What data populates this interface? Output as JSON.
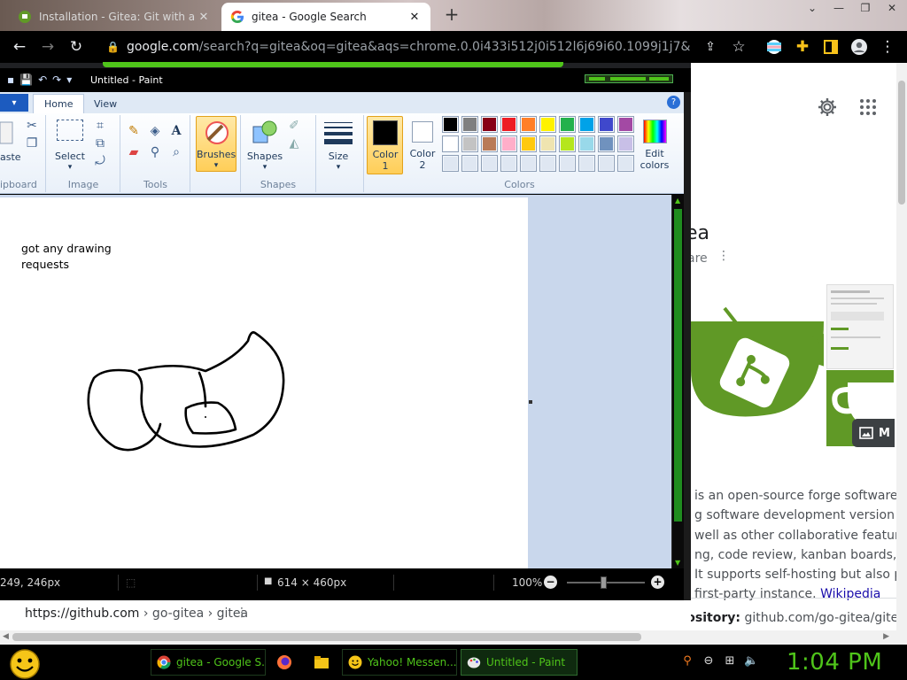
{
  "browser": {
    "tabs": [
      {
        "title": "Installation - Gitea: Git with a cu",
        "active": false
      },
      {
        "title": "gitea - Google Search",
        "active": true
      }
    ],
    "new_tab": "+",
    "close": "✕",
    "url_host": "google.com",
    "url_rest": "/search?q=gitea&oq=gitea&aqs=chrome.0.0i433i512j0i512l6j69i60.1099j1j7&sourceid=ch..."
  },
  "paint": {
    "window_title": "Untitled - Paint",
    "tabs": {
      "file": "▾",
      "home": "Home",
      "view": "View"
    },
    "help": "?",
    "ribbon": {
      "paste_label": "aste",
      "select_label": "Select",
      "brushes_label": "Brushes",
      "shapes_label": "Shapes",
      "size_label": "Size",
      "color1_label_1": "Color",
      "color1_label_2": "1",
      "color2_label_1": "Color",
      "color2_label_2": "2",
      "edit_colors_1": "Edit",
      "edit_colors_2": "colors",
      "groups": {
        "clipboard": "ipboard",
        "image": "Image",
        "tools": "Tools",
        "shapes": "Shapes",
        "colors": "Colors"
      }
    },
    "canvas_text_line1": "got any drawing",
    "canvas_text_line2": "requests",
    "status": {
      "position": "249, 246px",
      "canvas_size": "614 × 460px",
      "zoom": "100%"
    },
    "colors": {
      "row1": [
        "#000000",
        "#7f7f7f",
        "#880015",
        "#ed1c24",
        "#ff7f27",
        "#fff200",
        "#22b14c",
        "#00a2e8",
        "#3f48cc",
        "#a349a4"
      ],
      "row2": [
        "#ffffff",
        "#c3c3c3",
        "#b97a57",
        "#ffaec9",
        "#ffc90e",
        "#efe4b0",
        "#b5e61d",
        "#99d9ea",
        "#7092be",
        "#c8bfe7"
      ]
    }
  },
  "google": {
    "kp_title": "ea",
    "kp_subtitle": "are",
    "image_button": "M",
    "desc_lines": [
      "is an open-source forge software pac",
      "g software development version con",
      " well as other collaborative features l",
      "ng, code review, kanban boards, ticke",
      " It supports self-hosting but also prov",
      " first-party instance. "
    ],
    "desc_link": "Wikipedia",
    "repo_label": "Repository:",
    "repo_value": " github.com/go-gitea/gitea",
    "cite_host": "https://github.com",
    "cite_path": " › go-gitea › gitea"
  },
  "taskbar": {
    "tasks": [
      {
        "label": "gitea - Google S..."
      },
      {
        "label": "Yahoo! Messen..."
      },
      {
        "label": "Untitled - Paint"
      }
    ],
    "clock": "1:04 PM"
  },
  "theme": {
    "accent_green": "#4fc41a",
    "gitea_green": "#609926"
  }
}
